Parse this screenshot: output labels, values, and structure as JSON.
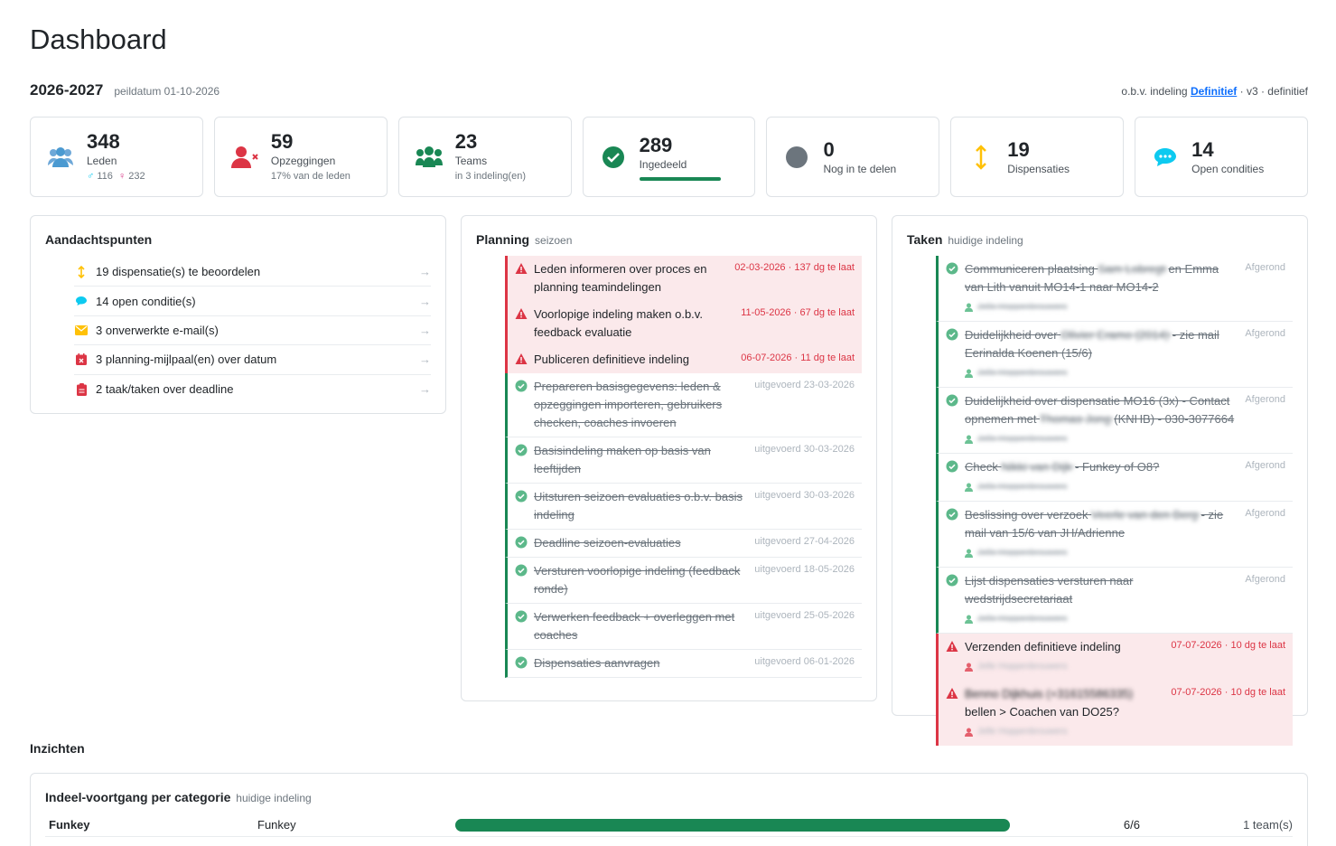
{
  "title": "Dashboard",
  "season": {
    "label": "2026-2027",
    "peildatum": "peildatum 01-10-2026",
    "obv_prefix": "o.b.v. indeling",
    "obv_link": "Definitief",
    "obv_suffix": "· v3 · definitief"
  },
  "stats": [
    {
      "icon": "people-icon",
      "value": "348",
      "label": "Leden",
      "male": "116",
      "female": "232"
    },
    {
      "icon": "user-x-icon",
      "value": "59",
      "label": "Opzeggingen",
      "sub": "17% van de leden"
    },
    {
      "icon": "teams-icon",
      "value": "23",
      "label": "Teams",
      "sub": "in 3 indeling(en)"
    },
    {
      "icon": "check-circle-icon",
      "value": "289",
      "label": "Ingedeeld",
      "progress": 1.0
    },
    {
      "icon": "grey-dot-icon",
      "value": "0",
      "label": "Nog in te delen"
    },
    {
      "icon": "vertical-arrows-icon",
      "value": "19",
      "label": "Dispensaties"
    },
    {
      "icon": "chat-bubble-icon",
      "value": "14",
      "label": "Open condities"
    }
  ],
  "attention": {
    "title": "Aandachtspunten",
    "items": [
      {
        "icon": "vertical-arrows-icon",
        "label": "19 dispensatie(s) te beoordelen"
      },
      {
        "icon": "chat-bubble-icon",
        "label": "14 open conditie(s)"
      },
      {
        "icon": "envelope-icon",
        "label": "3 onverwerkte e-mail(s)"
      },
      {
        "icon": "calendar-x-icon",
        "label": "3 planning-mijlpaal(en) over datum"
      },
      {
        "icon": "clipboard-icon",
        "label": "2 taak/taken over deadline"
      }
    ]
  },
  "planning": {
    "title": "Planning",
    "subtitle": "seizoen",
    "items": [
      {
        "status": "late",
        "text": "Leden informeren over proces en planning teamindelingen",
        "meta": "02-03-2026 · 137 dg te laat"
      },
      {
        "status": "late",
        "text": "Voorlopige indeling maken o.b.v. feedback evaluatie",
        "meta": "11-05-2026 · 67 dg te laat"
      },
      {
        "status": "late",
        "text": "Publiceren definitieve indeling",
        "meta": "06-07-2026 · 11 dg te laat"
      },
      {
        "status": "done",
        "text": "Prepareren basisgegevens: leden & opzeggingen importeren, gebruikers checken, coaches invoeren",
        "meta": "uitgevoerd 23-03-2026"
      },
      {
        "status": "done",
        "text": "Basisindeling maken op basis van leeftijden",
        "meta": "uitgevoerd 30-03-2026"
      },
      {
        "status": "done",
        "text": "Uitsturen seizoen evaluaties o.b.v. basis indeling",
        "meta": "uitgevoerd 30-03-2026"
      },
      {
        "status": "done",
        "text": "Deadline seizoen-evaluaties",
        "meta": "uitgevoerd 27-04-2026"
      },
      {
        "status": "done",
        "text": "Versturen voorlopige indeling (feedback ronde)",
        "meta": "uitgevoerd 18-05-2026"
      },
      {
        "status": "done",
        "text": "Verwerken feedback + overleggen met coaches",
        "meta": "uitgevoerd 25-05-2026"
      },
      {
        "status": "done",
        "text": "Dispensaties aanvragen",
        "meta": "uitgevoerd 06-01-2026"
      }
    ]
  },
  "tasks": {
    "title": "Taken",
    "subtitle": "huidige indeling",
    "items": [
      {
        "status": "done",
        "pre": "Communiceren plaatsing",
        "blur": "Sam Lobregt",
        "post": "en Emma van Lith vanuit MO14-1 naar MO14-2",
        "assignee": "Jelle Hoppenbrouwers",
        "meta": "Afgerond"
      },
      {
        "status": "done",
        "pre": "Duidelijkheid over",
        "blur": "Olivier Eramo (2014)",
        "post": "- zie mail Eerinalda Koenen (15/6)",
        "assignee": "Jelle Hoppenbrouwers",
        "meta": "Afgerond"
      },
      {
        "status": "done",
        "pre": "Duidelijkheid over dispensatie MO16 (3x) - Contact opnemen met",
        "blur": "Thomas Jong",
        "post": "(KNHB) - 030-3077664",
        "assignee": "Jelle Hoppenbrouwers",
        "meta": "Afgerond"
      },
      {
        "status": "done",
        "pre": "Check",
        "blur": "Nikki van Dijk",
        "post": "- Funkey of O8?",
        "assignee": "Jelle Hoppenbrouwers",
        "meta": "Afgerond"
      },
      {
        "status": "done",
        "pre": "Beslissing over verzoek",
        "blur": "Veerle van den Berg",
        "post": "- zie mail van 15/6 van JH/Adrienne",
        "assignee": "Jelle Hoppenbrouwers",
        "meta": "Afgerond"
      },
      {
        "status": "done",
        "pre": "Lijst dispensaties versturen naar wedstrijdsecretariaat",
        "blur": "",
        "post": "",
        "assignee": "Jelle Hoppenbrouwers",
        "meta": "Afgerond"
      },
      {
        "status": "late",
        "pre": "Verzenden definitieve indeling",
        "blur": "",
        "post": "",
        "assignee": "Jelle Hoppenbrouwers",
        "meta": "07-07-2026 · 10 dg te laat"
      },
      {
        "status": "late",
        "pre": "",
        "blur": "Benno Dijkhuis (+31615586335)",
        "post": "bellen > Coachen van DO25?",
        "assignee": "Jelle Hoppenbrouwers",
        "meta": "07-07-2026 · 10 dg te laat"
      }
    ]
  },
  "insights": {
    "title": "Inzichten",
    "card_title": "Indeel-voortgang per categorie",
    "card_subtitle": "huidige indeling",
    "rows": [
      {
        "category": "Funkey",
        "name": "Funkey",
        "progress": 1.0,
        "ratio": "6/6",
        "teams": "1 team(s)"
      }
    ]
  },
  "colors": {
    "success": "#198754",
    "danger": "#dc3545",
    "primary": "#0d6efd",
    "warning": "#ffc107",
    "info": "#0dcaf0",
    "male": "#0dcaf0",
    "female": "#d63384"
  }
}
